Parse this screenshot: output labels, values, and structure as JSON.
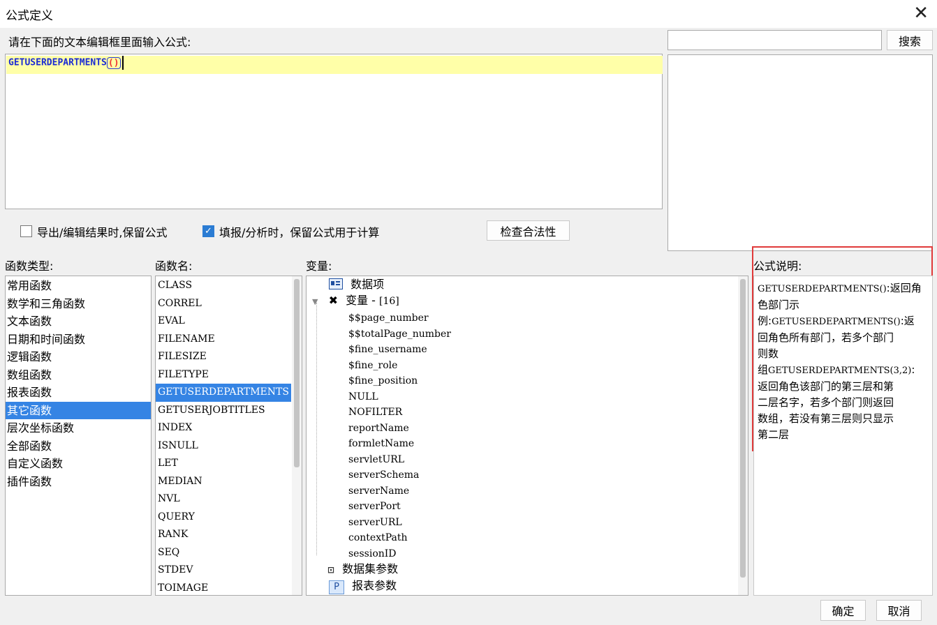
{
  "window": {
    "title": "公式定义"
  },
  "editor": {
    "prompt": "请在下面的文本编辑框里面输入公式:",
    "formula_name": "GETUSERDEPARTMENTS",
    "open_paren": "(",
    "close_paren": ")"
  },
  "search": {
    "value": "",
    "button_label": "搜索"
  },
  "options": {
    "keep_formula_export": {
      "label": "导出/编辑结果时,保留公式",
      "checked": false
    },
    "keep_formula_fill": {
      "label": "填报/分析时，保留公式用于计算",
      "checked": true
    },
    "check_button": "检查合法性"
  },
  "function_types": {
    "header": "函数类型:",
    "items": [
      "常用函数",
      "数学和三角函数",
      "文本函数",
      "日期和时间函数",
      "逻辑函数",
      "数组函数",
      "报表函数",
      "其它函数",
      "层次坐标函数",
      "全部函数",
      "自定义函数",
      "插件函数"
    ],
    "selected": "其它函数"
  },
  "function_names": {
    "header": "函数名:",
    "items": [
      "CLASS",
      "CORREL",
      "EVAL",
      "FILENAME",
      "FILESIZE",
      "FILETYPE",
      "GETUSERDEPARTMENTS",
      "GETUSERJOBTITLES",
      "INDEX",
      "ISNULL",
      "LET",
      "MEDIAN",
      "NVL",
      "QUERY",
      "RANK",
      "SEQ",
      "STDEV",
      "TOIMAGE"
    ],
    "selected": "GETUSERDEPARTMENTS"
  },
  "variables": {
    "header": "变量:",
    "data_items": "数据项",
    "var_group": "变量 - ",
    "var_count": "[16]",
    "leaves": [
      "$$page_number",
      "$$totalPage_number",
      "$fine_username",
      "$fine_role",
      "$fine_position",
      "NULL",
      "NOFILTER",
      "reportName",
      "formletName",
      "servletURL",
      "serverSchema",
      "serverName",
      "serverPort",
      "serverURL",
      "contextPath",
      "sessionID"
    ],
    "dataset_params": "数据集参数",
    "report_params": "报表参数",
    "p_icon_letter": "P"
  },
  "description": {
    "header": "公式说明:",
    "lines": [
      {
        "code": "GETUSERDEPARTMENTS()",
        "text": ":返回角"
      },
      {
        "code": "",
        "text": "色部门示"
      },
      {
        "code": "",
        "text": "例:",
        "code2": "GETUSERDEPARTMENTS()",
        "text2": ":返"
      },
      {
        "code": "",
        "text": "回角色所有部门，若多个部门"
      },
      {
        "code": "",
        "text": "则数"
      },
      {
        "code": "",
        "text": "组",
        "code2": "GETUSERDEPARTMENTS(3,2)",
        "text2": ":"
      },
      {
        "code": "",
        "text": "返回角色该部门的第三层和第"
      },
      {
        "code": "",
        "text": "二层名字，若多个部门则返回"
      },
      {
        "code": "",
        "text": "数组，若没有第三层则只显示"
      },
      {
        "code": "",
        "text": "第二层"
      }
    ],
    "highlight_color": "#e03a3a"
  },
  "footer": {
    "ok": "确定",
    "cancel": "取消"
  },
  "colors": {
    "selection": "#3584e4",
    "editor_line": "#ffffa8",
    "checkbox_on": "#2b7cd3"
  }
}
